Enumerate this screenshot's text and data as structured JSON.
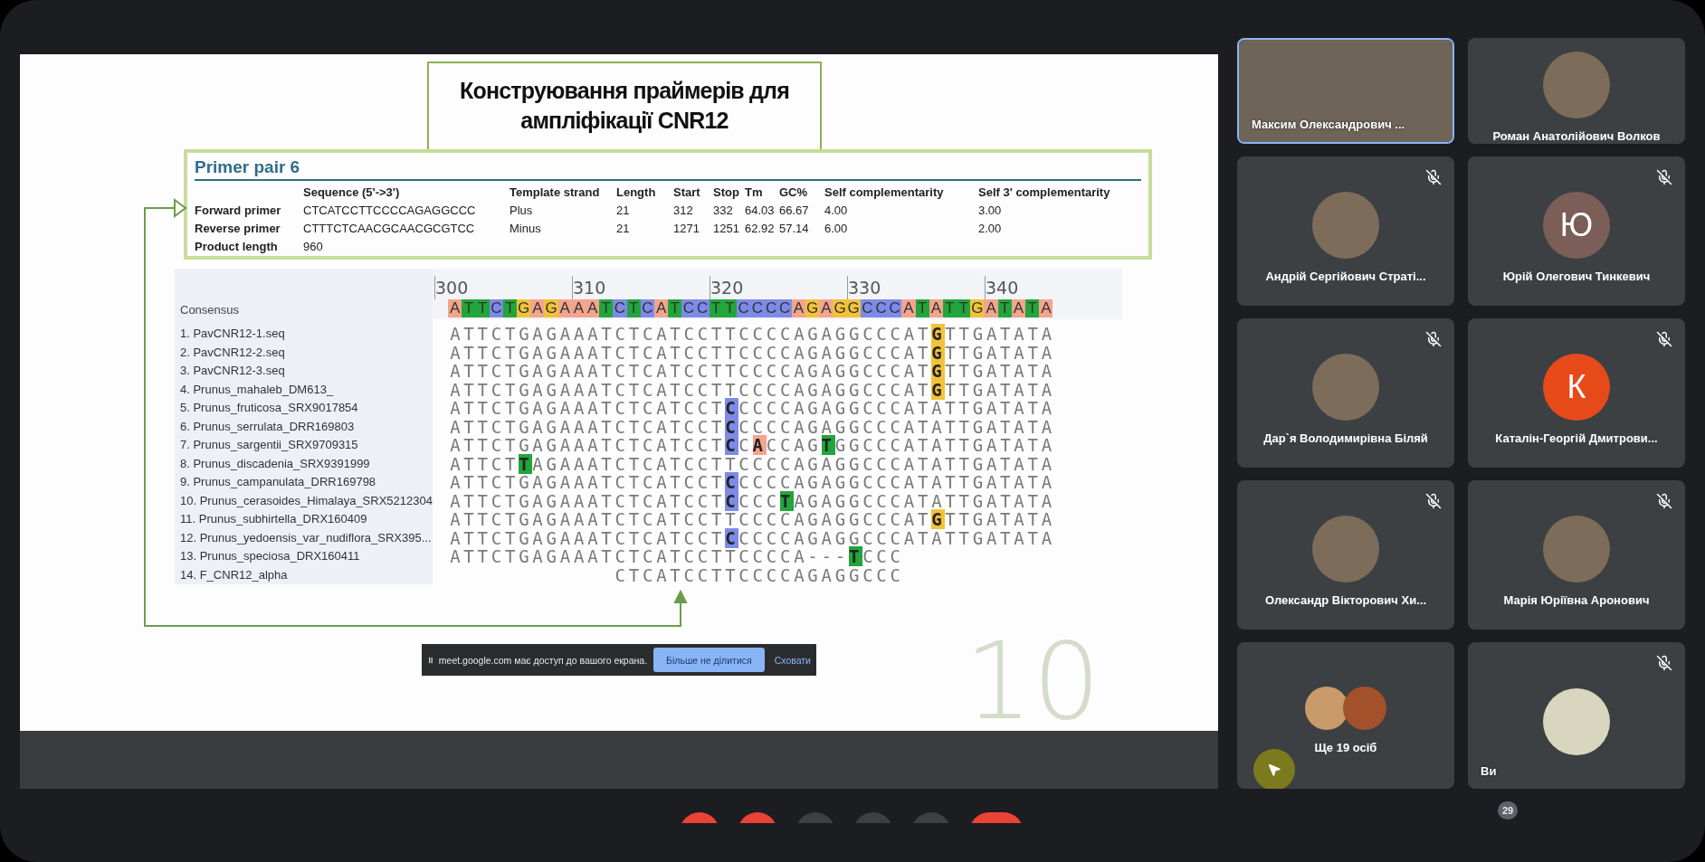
{
  "slide": {
    "title_lines": [
      "Конструювання праймерів для",
      "ампліфікації CNR12"
    ],
    "primer_pair": {
      "title": "Primer pair 6",
      "columns": [
        "Sequence (5'->3')",
        "Template strand",
        "Length",
        "Start",
        "Stop",
        "Tm",
        "GC%",
        "Self complementarity",
        "Self 3' complementarity"
      ],
      "rows": [
        {
          "label": "Forward primer",
          "cells": [
            "CTCATCCTTCCCCAGAGGCCC",
            "Plus",
            "21",
            "312",
            "332",
            "64.03",
            "66.67",
            "4.00",
            "3.00"
          ]
        },
        {
          "label": "Reverse primer",
          "cells": [
            "CTTTCTCAACGCAACGCGTCC",
            "Minus",
            "21",
            "1271",
            "1251",
            "62.92",
            "57.14",
            "6.00",
            "2.00"
          ]
        },
        {
          "label": "Product length",
          "cells": [
            "960"
          ]
        }
      ]
    },
    "alignment": {
      "ruler": [
        "300",
        "310",
        "320",
        "330",
        "340"
      ],
      "consensus": {
        "label": "Consensus",
        "sequence": "ATTCTGAGAAATCTCATCCTTCCCCAGAGGCCCATATTGATATA"
      },
      "rows": [
        {
          "name": "1. PavCNR12-1.seq",
          "sequence": "ATTCTGAGAAATCTCATCCTTCCCCAGAGGCCCATGTTGATATA"
        },
        {
          "name": "2. PavCNR12-2.seq",
          "sequence": "ATTCTGAGAAATCTCATCCTTCCCCAGAGGCCCATGTTGATATA"
        },
        {
          "name": "3. PavCNR12-3.seq",
          "sequence": "ATTCTGAGAAATCTCATCCTTCCCCAGAGGCCCATGTTGATATA"
        },
        {
          "name": "4. Prunus_mahaleb_DM613_",
          "sequence": "ATTCTGAGAAATCTCATCCTTCCCCAGAGGCCCATGTTGATATA"
        },
        {
          "name": "5. Prunus_fruticosa_SRX9017854",
          "sequence": "ATTCTGAGAAATCTCATCCTCCCCCAGAGGCCCATATTGATATA"
        },
        {
          "name": "6. Prunus_serrulata_DRR169803",
          "sequence": "ATTCTGAGAAATCTCATCCTCCCCCAGAGGCCCATATTGATATA"
        },
        {
          "name": "7. Prunus_sargentii_SRX9709315",
          "sequence": "ATTCTGAGAAATCTCATCCTCCACCAGTGGCCCATATTGATATA"
        },
        {
          "name": "8. Prunus_discadenia_SRX9391999",
          "sequence": "ATTCTTAGAAATCTCATCCTTCCCCAGAGGCCCATATTGATATA"
        },
        {
          "name": "9. Prunus_campanulata_DRR169798",
          "sequence": "ATTCTGAGAAATCTCATCCTCCCCCAGAGGCCCATATTGATATA"
        },
        {
          "name": "10. Prunus_cerasoides_Himalaya_SRX5212304",
          "sequence": "ATTCTGAGAAATCTCATCCTCCCCTAGAGGCCCATATTGATATA"
        },
        {
          "name": "11. Prunus_subhirtella_DRX160409",
          "sequence": "ATTCTGAGAAATCTCATCCTTCCCCAGAGGCCCATGTTGATATA"
        },
        {
          "name": "12. Prunus_yedoensis_var_nudiflora_SRX395...",
          "sequence": "ATTCTGAGAAATCTCATCCTCCCCCAGAGGCCCATATTGATATA"
        },
        {
          "name": "13. Prunus_speciosa_DRX160411",
          "sequence": "ATTCTGAGAAATCTCATCCTTCCCCA---TCCC"
        },
        {
          "name": "14. F_CNR12_alpha",
          "sequence": "            CTCATCCTTCCCCAGAGGCCC"
        }
      ]
    },
    "page_number": "10",
    "share_bar": {
      "message": "meet.google.com має доступ до вашого екрана.",
      "stop_button": "Більше не ділитися",
      "hide_link": "Сховати"
    }
  },
  "call_controls": [
    {
      "color": "#ea4335"
    },
    {
      "color": "#ea4335"
    },
    {
      "color": "#3c4043"
    },
    {
      "color": "#3c4043"
    },
    {
      "color": "#3c4043"
    },
    {
      "color": "#ea4335"
    }
  ],
  "participants": [
    {
      "name": "Максим Олександрович ...",
      "kind": "video",
      "muted": false,
      "speaking": true
    },
    {
      "name": "Роман Анатолійович Волков",
      "kind": "photo",
      "muted": false,
      "speaking": false
    },
    {
      "name": "Андрій Сергійович Страті...",
      "kind": "photo",
      "muted": true,
      "speaking": false
    },
    {
      "name": "Юрій Олегович Тинкевич",
      "kind": "letter",
      "initial": "Ю",
      "color": "#7b5e57",
      "muted": true,
      "speaking": false
    },
    {
      "name": "Дар`я Володимирівна Біляй",
      "kind": "photo",
      "muted": true,
      "speaking": false
    },
    {
      "name": "Каталін-Георгій Дмитрови...",
      "kind": "letter",
      "initial": "К",
      "color": "#e64a19",
      "muted": true,
      "speaking": false
    },
    {
      "name": "Олександр Вікторович Хи...",
      "kind": "photo",
      "muted": true,
      "speaking": false
    },
    {
      "name": "Марія Юріївна Аронович",
      "kind": "photo",
      "muted": true,
      "speaking": false
    },
    {
      "name": "Ще 19 осіб",
      "kind": "group",
      "muted": false,
      "speaking": false
    },
    {
      "name": "Ви",
      "kind": "self",
      "muted": true,
      "speaking": false
    }
  ],
  "participant_count": "29"
}
